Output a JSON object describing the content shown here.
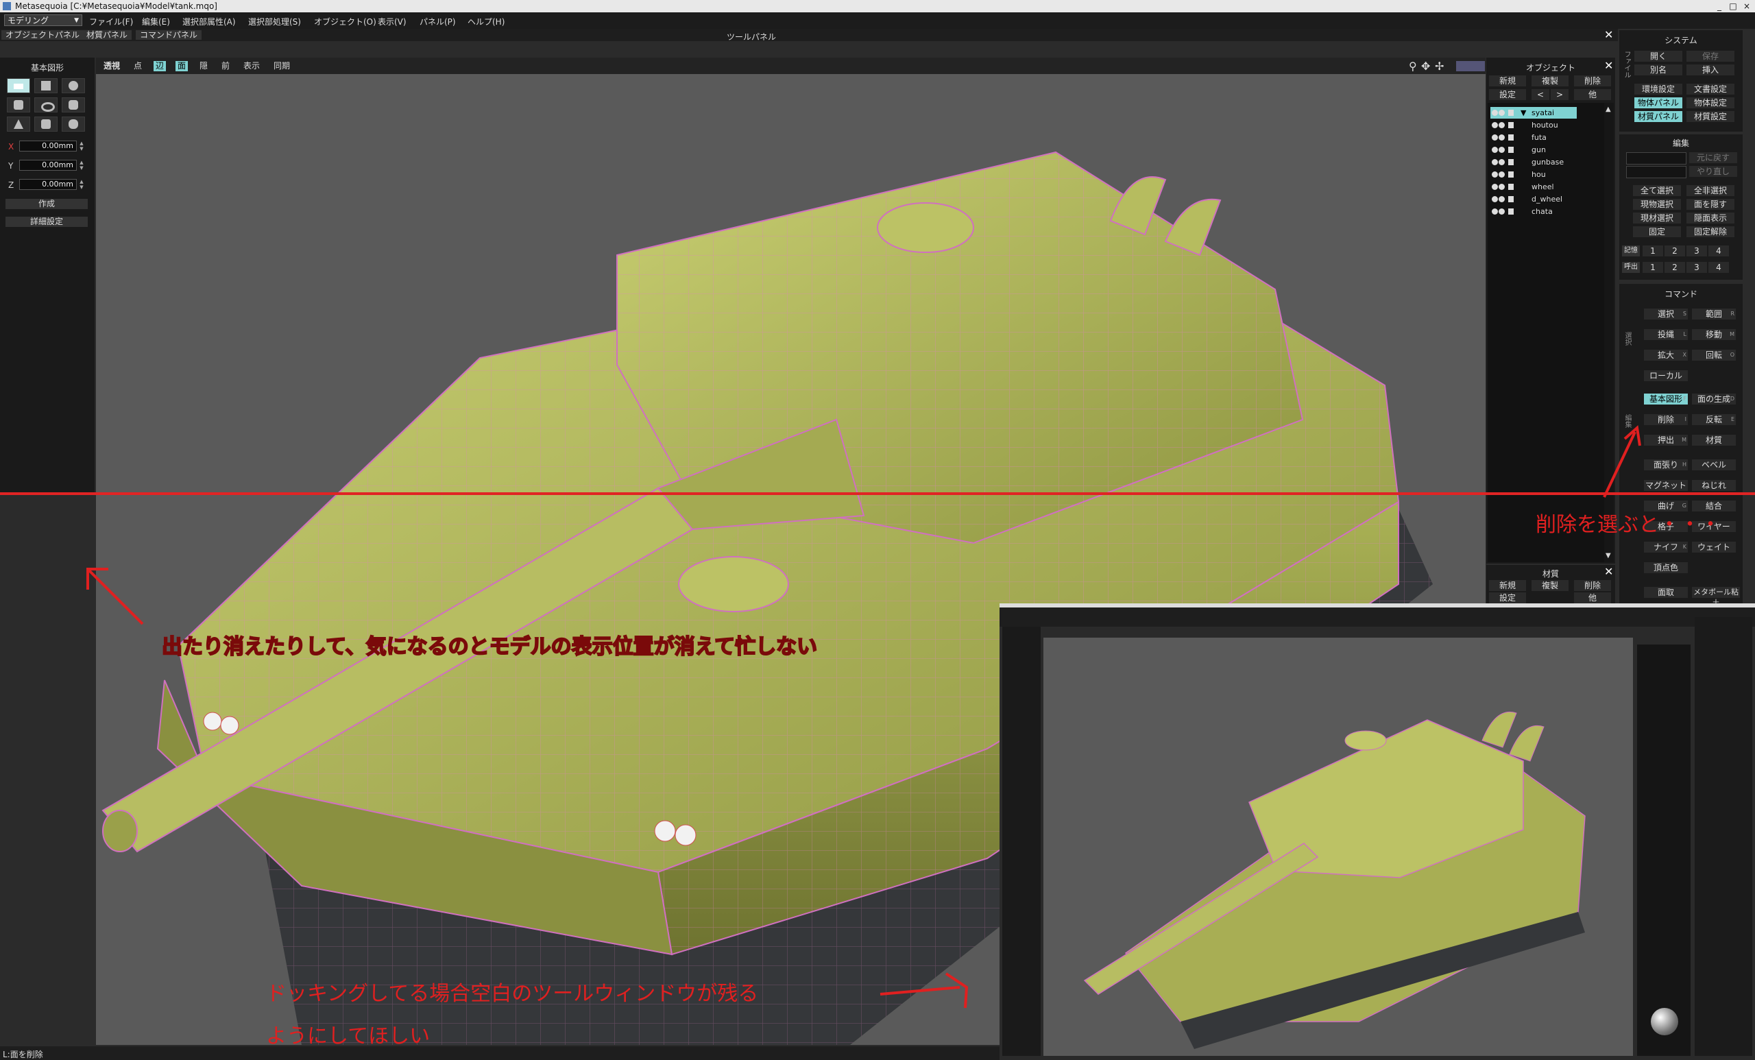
{
  "window": {
    "title": "Metasequoia [C:¥Metasequoia¥Model¥tank.mqo]",
    "min": "_",
    "max": "□",
    "close": "×"
  },
  "menu": {
    "mode": "モデリング",
    "items": [
      "ファイル(F)",
      "編集(E)",
      "選択部属性(A)",
      "選択部処理(S)",
      "オブジェクト(O)",
      "表示(V)",
      "パネル(P)",
      "ヘルプ(H)"
    ]
  },
  "panel_tabs": [
    "オブジェクトパネル",
    "材質パネル",
    "コマンドパネル"
  ],
  "tool_panel": {
    "title": "ツールパネル",
    "close": "✕"
  },
  "basic_shapes": {
    "title": "基本図形",
    "axes": [
      {
        "label": "X",
        "value": "0.00mm"
      },
      {
        "label": "Y",
        "value": "0.00mm"
      },
      {
        "label": "Z",
        "value": "0.00mm"
      }
    ],
    "create": "作成",
    "details": "詳細設定"
  },
  "view_toolbar": [
    "透視",
    "点",
    "辺",
    "面",
    "隠",
    "前",
    "表示",
    "同期"
  ],
  "object_panel": {
    "title": "オブジェクト",
    "buttons_row1": [
      "新規",
      "複製",
      "削除"
    ],
    "buttons_row2": [
      "設定",
      "<",
      ">",
      "他"
    ],
    "objects": [
      "syatai",
      "houtou",
      "futa",
      "gun",
      "gunbase",
      "hou",
      "wheel",
      "d_wheel",
      "chata"
    ]
  },
  "material_panel": {
    "title": "材質",
    "buttons_row1": [
      "新規",
      "複製",
      "削除"
    ],
    "buttons_row2": [
      "設定",
      "他"
    ]
  },
  "system_panel": {
    "title": "システム",
    "side": "ファイル",
    "rows": [
      [
        "開く",
        "保存"
      ],
      [
        "別名",
        "挿入"
      ],
      [
        "環境設定",
        "文書設定"
      ],
      [
        "物体パネル",
        "物体設定"
      ],
      [
        "材質パネル",
        "材質設定"
      ]
    ]
  },
  "edit_panel": {
    "title": "編集",
    "rows": [
      [
        "",
        "元に戻す"
      ],
      [
        "",
        "やり直し"
      ],
      [
        "全て選択",
        "全非選択"
      ],
      [
        "現物選択",
        "面を隠す"
      ],
      [
        "現材選択",
        "隠面表示"
      ],
      [
        "固定",
        "固定解除"
      ]
    ],
    "mem_label": "記憶",
    "load_label": "呼出",
    "nums": [
      "1",
      "2",
      "3",
      "4"
    ]
  },
  "command_panel": {
    "title": "コマンド",
    "side1": "選択",
    "side2": "編集",
    "rows": [
      [
        "選択",
        "範囲"
      ],
      [
        "投縄",
        "移動"
      ],
      [
        "拡大",
        "回転"
      ],
      [
        "ローカル",
        ""
      ],
      [
        "基本図形",
        "面の生成"
      ],
      [
        "削除",
        "反転"
      ],
      [
        "押出",
        "材質"
      ],
      [
        "面張り",
        "ベベル"
      ],
      [
        "マグネット",
        "ねじれ"
      ],
      [
        "曲げ",
        "結合"
      ],
      [
        "格子",
        "ワイヤー"
      ],
      [
        "ナイフ",
        "ウェイト"
      ],
      [
        "頂点色",
        ""
      ],
      [
        "面取",
        "メタボール粘土"
      ]
    ],
    "shortcuts": [
      "S",
      "R",
      "L",
      "M",
      "X",
      "O",
      "",
      "",
      "F",
      "D",
      "I",
      "E",
      "M",
      "",
      "",
      "H",
      "",
      "",
      "",
      "",
      "G",
      "",
      "",
      "",
      "K",
      "",
      ""
    ]
  },
  "status": "L:面を削除",
  "annotations": {
    "a1": "削除を選ぶと・・・",
    "a2": "出たり消えたりして、気になるのとモデルの表示位置が消えて忙しない",
    "a3": "ドッキングしてる場合空白のツールウィンドウが残る",
    "a4": "ようにしてほしい"
  }
}
